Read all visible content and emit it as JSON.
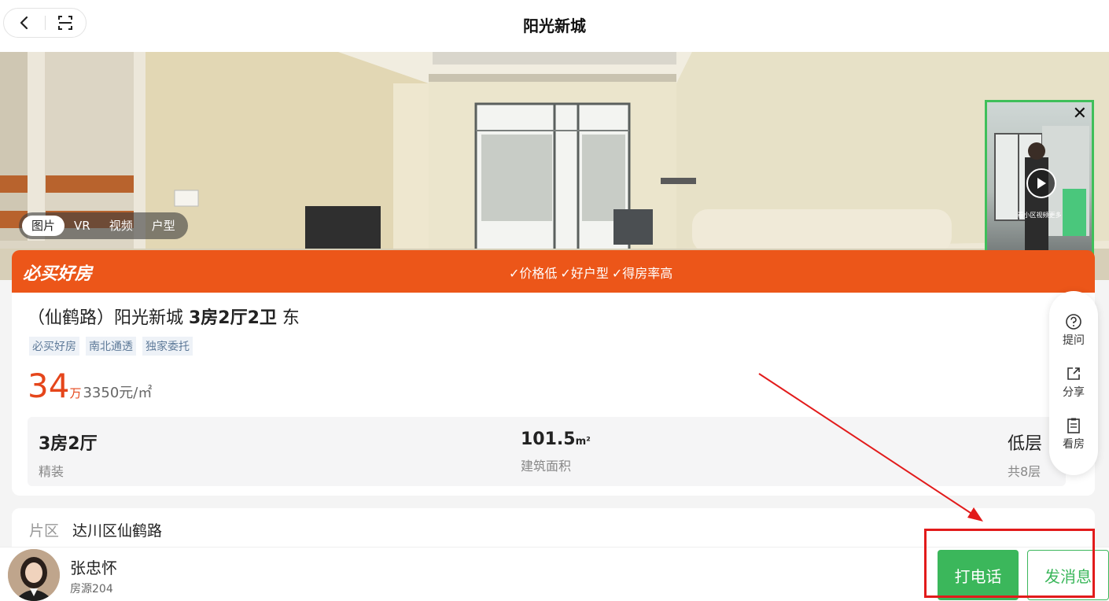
{
  "header": {
    "title": "阳光新城"
  },
  "media_tabs": [
    "图片",
    "VR",
    "视频",
    "户型"
  ],
  "video": {
    "caption": "看小区视频更多"
  },
  "banner": {
    "title": "必买好房",
    "features": [
      "✓价格低",
      "✓好户型",
      "✓得房率高"
    ]
  },
  "listing": {
    "title_prefix": "（仙鹤路）阳光新城 ",
    "title_layout": "3房2厅2卫",
    "title_suffix": " 东",
    "tags": [
      "必买好房",
      "南北通透",
      "独家委托"
    ],
    "price": "34",
    "price_unit": "万",
    "unit_price": "3350元/㎡"
  },
  "stats": {
    "layout": {
      "value": "3房2厅",
      "label": "精装"
    },
    "area": {
      "value": "101.5",
      "unit": "m²",
      "label": "建筑面积"
    },
    "floor": {
      "value": "低层",
      "label": "共8层"
    }
  },
  "side_actions": [
    {
      "label": "提问",
      "icon": "question-icon"
    },
    {
      "label": "分享",
      "icon": "share-icon"
    },
    {
      "label": "看房",
      "icon": "clipboard-icon"
    }
  ],
  "district": {
    "label": "片区",
    "value": "达川区仙鹤路"
  },
  "agent": {
    "name": "张忠怀",
    "listings": "房源204"
  },
  "buttons": {
    "call": "打电话",
    "message": "发消息"
  },
  "colors": {
    "accent_orange": "#ec5619",
    "price_red": "#e5461b",
    "green": "#3bb75b",
    "annotation_red": "#e21b1b"
  }
}
